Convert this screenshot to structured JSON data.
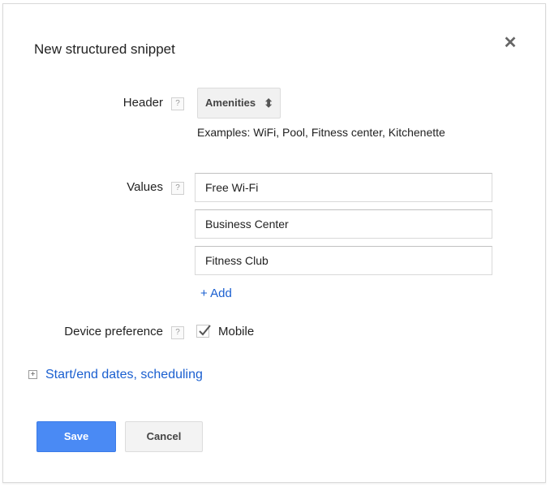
{
  "dialog": {
    "title": "New structured snippet",
    "close_icon": "close-icon"
  },
  "header_field": {
    "label": "Header",
    "help": "?",
    "selected": "Amenities",
    "select_icon": "sort-arrows-icon",
    "examples": "Examples: WiFi, Pool, Fitness center, Kitchenette"
  },
  "values_field": {
    "label": "Values",
    "help": "?",
    "inputs": [
      "Free Wi-Fi",
      "Business Center",
      "Fitness Club"
    ],
    "add_label": "+ Add"
  },
  "device_field": {
    "label": "Device preference",
    "help": "?",
    "checkbox_label": "Mobile",
    "checked": true
  },
  "scheduling": {
    "expand_icon": "plus-box-icon",
    "label": "Start/end dates, scheduling"
  },
  "buttons": {
    "save": "Save",
    "cancel": "Cancel"
  },
  "colors": {
    "primary": "#4a8af4",
    "link": "#1a5fd0"
  }
}
